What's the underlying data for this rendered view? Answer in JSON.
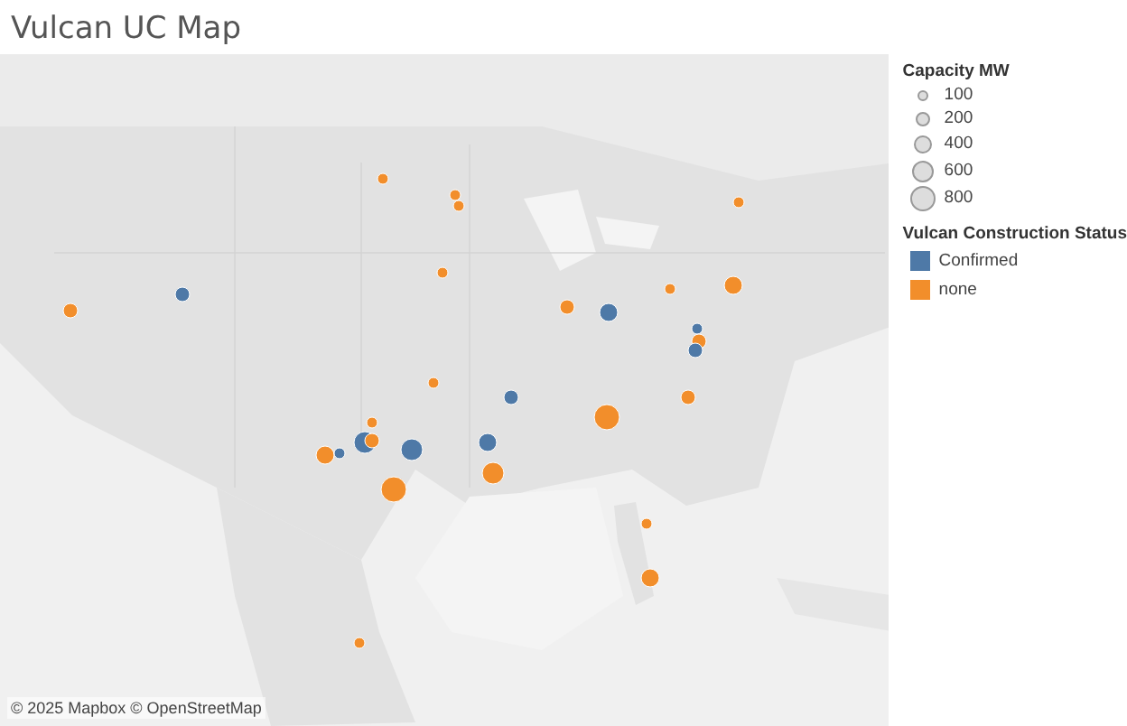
{
  "title": "Vulcan UC Map",
  "map": {
    "kind": "picture",
    "attribution": "© 2025 Mapbox © OpenStreetMap"
  },
  "legend": {
    "size_title": "Capacity MW",
    "sizes": [
      {
        "label": "100"
      },
      {
        "label": "200"
      },
      {
        "label": "400"
      },
      {
        "label": "600"
      },
      {
        "label": "800"
      }
    ],
    "color_title": "Vulcan Construction Status",
    "statuses": [
      {
        "label": "Confirmed",
        "color": "#4e79a7"
      },
      {
        "label": "none",
        "color": "#f28e2b"
      }
    ]
  }
}
